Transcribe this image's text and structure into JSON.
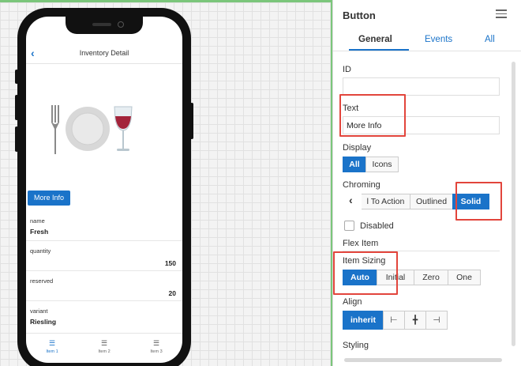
{
  "canvas": {
    "phone": {
      "header": {
        "back_icon": "chevron-left-icon",
        "title": "Inventory Detail"
      },
      "button_label": "More Info",
      "fields": [
        {
          "label": "name",
          "value": "Fresh",
          "align": "left"
        },
        {
          "label": "quantity",
          "value": "150",
          "align": "right"
        },
        {
          "label": "reserved",
          "value": "20",
          "align": "right"
        },
        {
          "label": "variant",
          "value": "Riesling",
          "align": "left"
        }
      ],
      "tabs": [
        {
          "label": "Item 1",
          "icon": "list-icon",
          "active": true
        },
        {
          "label": "Item 2",
          "icon": "list-icon",
          "active": false
        },
        {
          "label": "Item 3",
          "icon": "list-icon",
          "active": false
        }
      ]
    }
  },
  "panel": {
    "title": "Button",
    "menu_icon": "hamburger-menu-icon",
    "tabs": [
      "General",
      "Events",
      "All"
    ],
    "active_tab": "General",
    "id_label": "ID",
    "id_value": "",
    "text_label": "Text",
    "text_value": "More Info",
    "display_label": "Display",
    "display_options": [
      "All",
      "Icons"
    ],
    "display_selected": "All",
    "chroming_label": "Chroming",
    "chroming_options": [
      "l To Action",
      "Outlined",
      "Solid"
    ],
    "chroming_selected": "Solid",
    "disabled_label": "Disabled",
    "flex_item_label": "Flex Item",
    "item_sizing_label": "Item Sizing",
    "item_sizing_options": [
      "Auto",
      "Initial",
      "Zero",
      "One"
    ],
    "item_sizing_selected": "Auto",
    "align_label": "Align",
    "align_options": [
      "inherit",
      "align-start-icon",
      "align-center-icon",
      "align-end-icon"
    ],
    "align_selected": "inherit",
    "styling_label": "Styling"
  },
  "colors": {
    "accent": "#1a73c9",
    "highlight": "#e2453c",
    "canvas_border": "#7bc67b"
  }
}
